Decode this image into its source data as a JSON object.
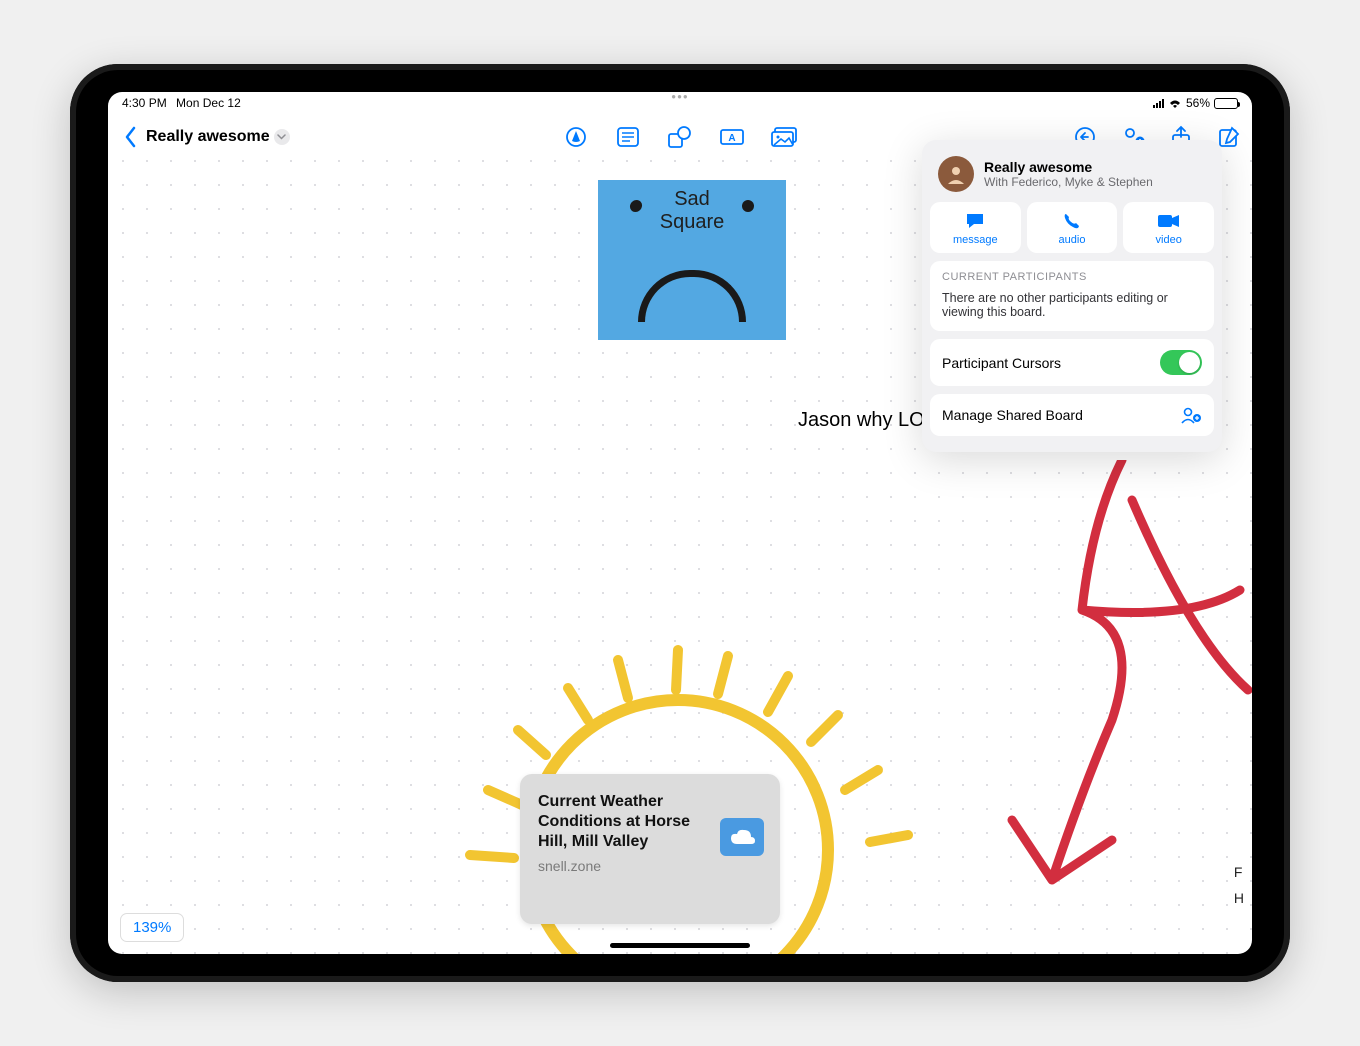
{
  "status": {
    "time": "4:30 PM",
    "date": "Mon Dec 12",
    "battery_pct": "56%"
  },
  "board": {
    "title": "Really awesome"
  },
  "tools": [
    "pen",
    "note",
    "shapes",
    "textbox",
    "photo"
  ],
  "right_actions": [
    "undo",
    "collaborate",
    "share",
    "compose"
  ],
  "canvas": {
    "sticky_label_line1": "Sad",
    "sticky_label_line2": "Square",
    "text1": "Jason why LOL",
    "link_card": {
      "title": "Current Weather Conditions at Horse Hill, Mill Valley",
      "domain": "snell.zone"
    },
    "edge_text_top": "F",
    "edge_text_bot": "H"
  },
  "zoom": "139%",
  "popover": {
    "title": "Really awesome",
    "subtitle": "With Federico, Myke & Stephen",
    "actions": {
      "message": "message",
      "audio": "audio",
      "video": "video"
    },
    "participants_header": "CURRENT PARTICIPANTS",
    "participants_text": "There are no other participants editing or viewing this board.",
    "cursors_label": "Participant Cursors",
    "manage_label": "Manage Shared Board"
  },
  "colors": {
    "accent": "#007aff",
    "sticky": "#53a8e2",
    "toggle_on": "#34c759",
    "sun": "#f2c531",
    "red_stroke": "#d22e3f"
  }
}
